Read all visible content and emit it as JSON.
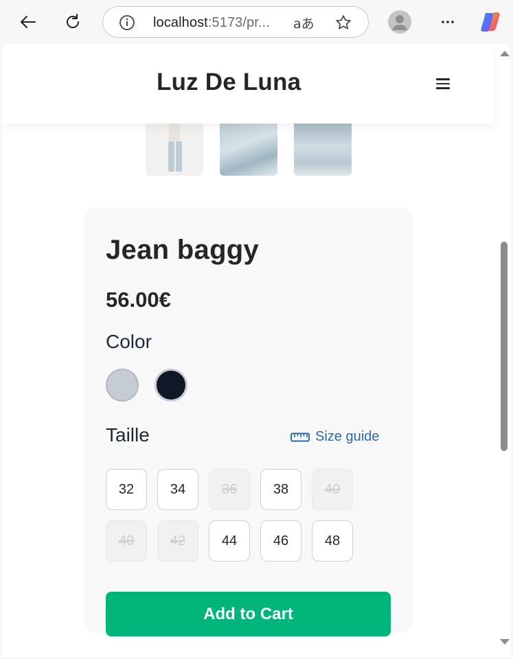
{
  "browser": {
    "url_host": "localhost",
    "url_rest": ":5173/pr...",
    "translate_glyph": "aあ",
    "icons": [
      "back-arrow-icon",
      "reload-icon",
      "info-icon",
      "translate-icon",
      "star-icon",
      "profile-icon",
      "more-icon",
      "copilot-icon"
    ]
  },
  "header": {
    "brand": "Luz De Luna",
    "menu_icon": "hamburger-icon"
  },
  "product": {
    "title": "Jean baggy",
    "price": "56.00€",
    "color_label": "Color",
    "colors": [
      {
        "name": "light-gray",
        "hex": "#c6ccd3"
      },
      {
        "name": "navy",
        "hex": "#101828"
      }
    ],
    "size_label": "Taille",
    "size_guide": "Size guide",
    "sizes": [
      {
        "label": "32",
        "available": true
      },
      {
        "label": "34",
        "available": true
      },
      {
        "label": "36",
        "available": false
      },
      {
        "label": "38",
        "available": true
      },
      {
        "label": "40",
        "available": false
      },
      {
        "label": "40",
        "available": false
      },
      {
        "label": "42",
        "available": false
      },
      {
        "label": "44",
        "available": true
      },
      {
        "label": "46",
        "available": true
      },
      {
        "label": "48",
        "available": true
      }
    ],
    "add_to_cart": "Add to Cart"
  },
  "colors": {
    "accent": "#00b57a",
    "link": "#2b6aa8",
    "text": "#262626"
  }
}
